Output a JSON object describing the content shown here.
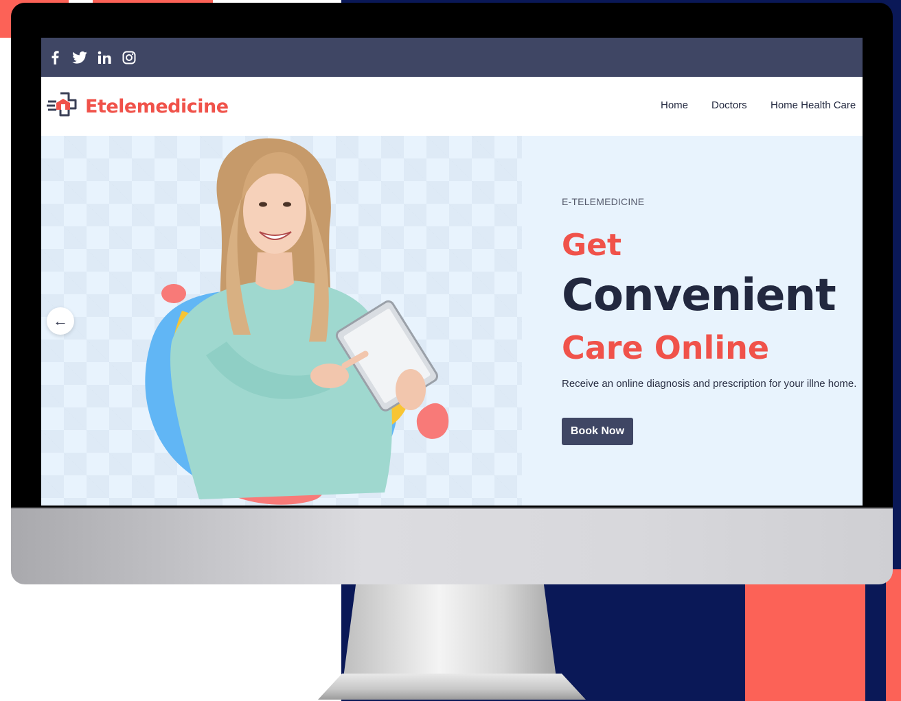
{
  "social_icons": [
    "facebook-icon",
    "twitter-icon",
    "linkedin-icon",
    "instagram-icon"
  ],
  "brand": {
    "name": "Etelemedicine",
    "accent": "#f0524a",
    "navy": "#3f4664"
  },
  "nav": {
    "items": [
      "Home",
      "Doctors",
      "Home Health Care"
    ]
  },
  "hero": {
    "eyebrow": "E-TELEMEDICINE",
    "heading_1": "Get",
    "heading_2": "Convenient",
    "heading_3": "Care Online",
    "description": "Receive an online diagnosis and prescription for your illne home.",
    "cta": "Book Now",
    "prev_arrow": "←"
  }
}
